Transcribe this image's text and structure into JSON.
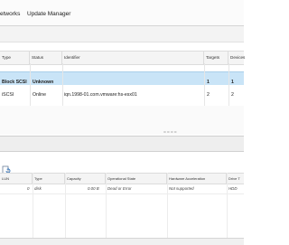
{
  "top_tabs": [
    "etworks",
    "Update Manager"
  ],
  "upper_grid": {
    "columns": [
      "Type",
      "Status",
      "Identifier",
      "Targets",
      "Devices"
    ],
    "rows": [
      {
        "type": "Block SCSI",
        "status": "Unknown",
        "identifier": "",
        "targets": "1",
        "devices": "1"
      },
      {
        "type": "iSCSI",
        "status": "Online",
        "identifier": "iqn.1998-01.com.vmware:hs-esx01",
        "targets": "2",
        "devices": "2"
      }
    ]
  },
  "lower_toolbar": {
    "icon": "document-refresh-icon",
    "dropdown": "chevron-down-icon"
  },
  "lower_grid": {
    "columns": [
      "LUN",
      "Type",
      "Capacity",
      "Operational State",
      "Hardware Acceleration",
      "Drive T"
    ],
    "rows": [
      {
        "lun": "0",
        "type": "disk",
        "capacity": "0.00 B",
        "state": "Dead or Error",
        "hw_accel": "Not supported",
        "drive_type": "HDD"
      }
    ]
  },
  "splitter_grip": "====",
  "colors": {
    "selected_row": "#c9e4f7",
    "header": "#f4f4f4"
  }
}
